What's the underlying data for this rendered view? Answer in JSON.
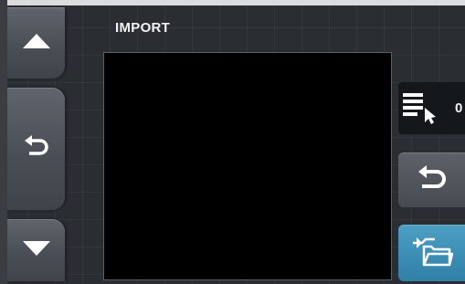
{
  "screen": {
    "title": "IMPORT"
  },
  "sidebar": {
    "items": [
      {
        "icon": "arrow-up-icon"
      },
      {
        "icon": "return-icon"
      },
      {
        "icon": "arrow-down-icon"
      }
    ]
  },
  "right_panel": {
    "selection_count": "0",
    "icons": [
      "list-select-icon",
      "undo-icon",
      "folder-import-icon"
    ],
    "accent_color": "#3a8fb8"
  }
}
